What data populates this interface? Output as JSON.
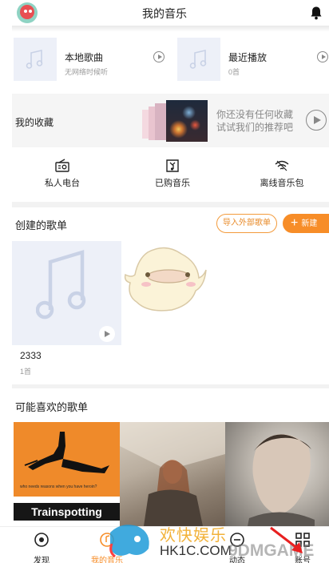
{
  "header": {
    "title": "我的音乐"
  },
  "recent": [
    {
      "title": "本地歌曲",
      "subtitle": "无网络时候听"
    },
    {
      "title": "最近播放",
      "subtitle": "0首"
    }
  ],
  "favorites": {
    "label": "我的收藏",
    "message_line1": "你还没有任何收藏",
    "message_line2": "试试我们的推荐吧"
  },
  "quick_actions": [
    {
      "label": "私人电台",
      "icon": "radio-icon"
    },
    {
      "label": "已购音乐",
      "icon": "purchased-music-icon"
    },
    {
      "label": "离线音乐包",
      "icon": "wifi-offline-icon"
    }
  ],
  "created_playlists": {
    "title": "创建的歌单",
    "import_label": "导入外部歌单",
    "new_label": "新建",
    "items": [
      {
        "name": "2333",
        "count": "1首"
      }
    ]
  },
  "recommended": {
    "title": "可能喜欢的歌单",
    "cover1_title": "Trainspotting",
    "cover1_caption": "who needs reasons when you have heroin?"
  },
  "tabbar": [
    {
      "label": "发现"
    },
    {
      "label": "我的音乐"
    },
    {
      "label": "动态"
    },
    {
      "label": "账号"
    }
  ],
  "watermarks": {
    "site1": "HK1C.COM",
    "site2": "9DMGAME",
    "brand": "欢快娱乐"
  },
  "colors": {
    "accent": "#f78d28",
    "accent_text": "#e88b2a",
    "tile_bg": "#edf0f8",
    "muted_text": "#9a9a9a"
  }
}
